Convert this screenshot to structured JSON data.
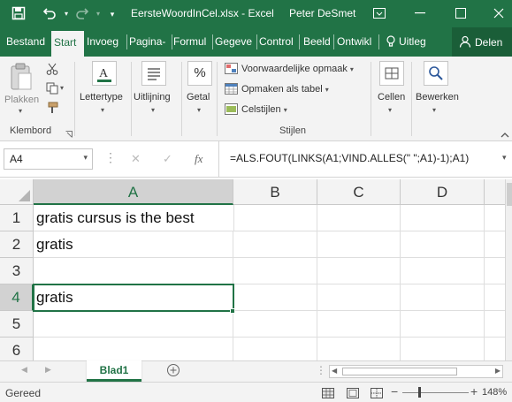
{
  "window": {
    "title": "EersteWoordInCel.xlsx  -  Excel",
    "user": "Peter DeSmet",
    "accent": "#217346"
  },
  "tabs": [
    {
      "label": "Bestand",
      "active": false
    },
    {
      "label": "Start",
      "active": true
    },
    {
      "label": "Invoeg",
      "active": false
    },
    {
      "label": "Pagina-",
      "active": false
    },
    {
      "label": "Formul",
      "active": false
    },
    {
      "label": "Gegeve",
      "active": false
    },
    {
      "label": "Control",
      "active": false
    },
    {
      "label": "Beeld",
      "active": false
    },
    {
      "label": "Ontwikl",
      "active": false
    }
  ],
  "tell_me": "Uitleg",
  "share": "Delen",
  "ribbon": {
    "paste": "Plakken",
    "clipboard": "Klembord",
    "font": "Lettertype",
    "alignment": "Uitlijning",
    "number": "Getal",
    "number_symbol": "%",
    "conditional_formatting": "Voorwaardelijke opmaak",
    "format_as_table": "Opmaken als tabel",
    "cell_styles": "Celstijlen",
    "styles": "Stijlen",
    "cells": "Cellen",
    "editing": "Bewerken"
  },
  "formula_bar": {
    "name_box": "A4",
    "fx": "fx",
    "formula": "=ALS.FOUT(LINKS(A1;VIND.ALLES(\" \";A1)-1);A1)"
  },
  "grid": {
    "columns": [
      "A",
      "B",
      "C",
      "D"
    ],
    "rows": [
      "1",
      "2",
      "3",
      "4",
      "5",
      "6"
    ],
    "cells": {
      "A1": "gratis cursus is the best",
      "A2": "gratis",
      "A3": "",
      "A4": "gratis",
      "A5": "",
      "A6": ""
    },
    "active_cell": "A4"
  },
  "sheets": [
    {
      "label": "Blad1",
      "active": true
    }
  ],
  "status": {
    "ready": "Gereed",
    "zoom": "148%"
  }
}
